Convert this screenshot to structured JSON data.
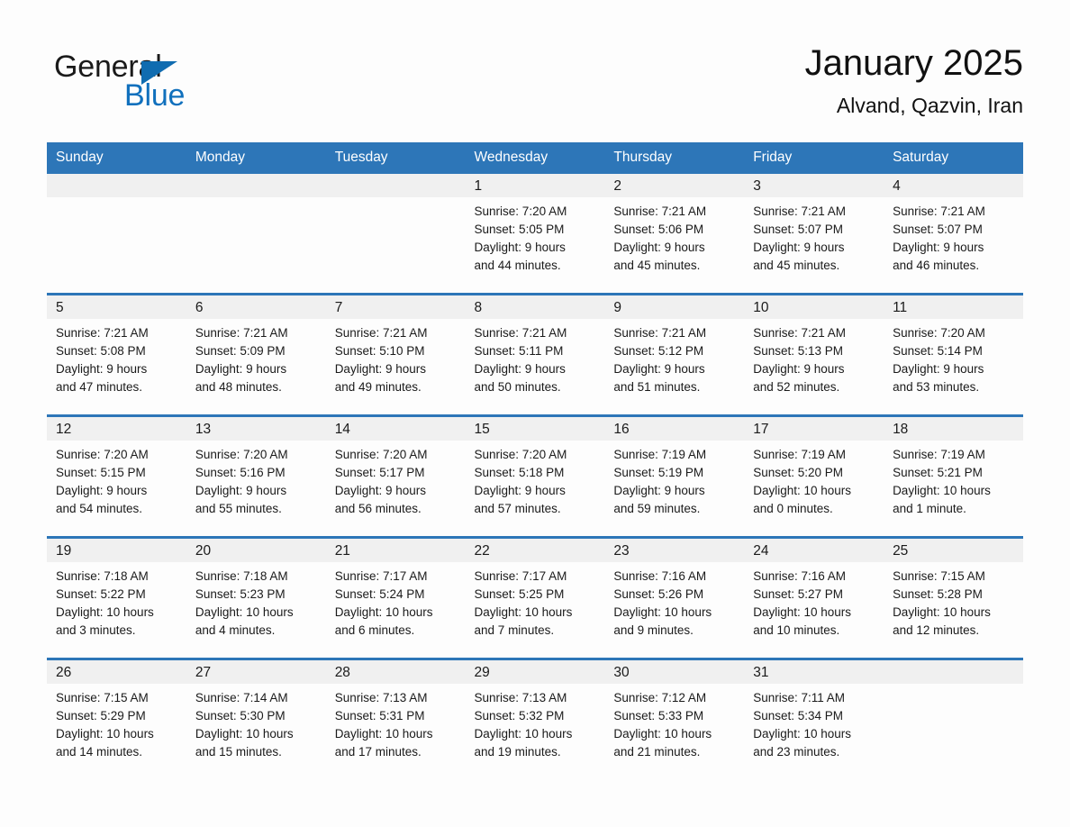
{
  "brand": {
    "name_part1": "General",
    "name_part2": "Blue",
    "accent_color": "#1070bd",
    "triangle_color": "#106cb0"
  },
  "header": {
    "title": "January 2025",
    "subtitle": "Alvand, Qazvin, Iran"
  },
  "theme": {
    "header_row_bg": "#2d76b8",
    "daynum_bg": "#f0f0f0",
    "page_bg": "#fdfdfd",
    "text_color": "#1a1a1a"
  },
  "weekday_headers": [
    "Sunday",
    "Monday",
    "Tuesday",
    "Wednesday",
    "Thursday",
    "Friday",
    "Saturday"
  ],
  "weeks": [
    [
      {
        "day": "",
        "empty": true,
        "sunrise": "",
        "sunset": "",
        "daylight_line1": "",
        "daylight_line2": ""
      },
      {
        "day": "",
        "empty": true,
        "sunrise": "",
        "sunset": "",
        "daylight_line1": "",
        "daylight_line2": ""
      },
      {
        "day": "",
        "empty": true,
        "sunrise": "",
        "sunset": "",
        "daylight_line1": "",
        "daylight_line2": ""
      },
      {
        "day": "1",
        "sunrise": "Sunrise: 7:20 AM",
        "sunset": "Sunset: 5:05 PM",
        "daylight_line1": "Daylight: 9 hours",
        "daylight_line2": "and 44 minutes."
      },
      {
        "day": "2",
        "sunrise": "Sunrise: 7:21 AM",
        "sunset": "Sunset: 5:06 PM",
        "daylight_line1": "Daylight: 9 hours",
        "daylight_line2": "and 45 minutes."
      },
      {
        "day": "3",
        "sunrise": "Sunrise: 7:21 AM",
        "sunset": "Sunset: 5:07 PM",
        "daylight_line1": "Daylight: 9 hours",
        "daylight_line2": "and 45 minutes."
      },
      {
        "day": "4",
        "sunrise": "Sunrise: 7:21 AM",
        "sunset": "Sunset: 5:07 PM",
        "daylight_line1": "Daylight: 9 hours",
        "daylight_line2": "and 46 minutes."
      }
    ],
    [
      {
        "day": "5",
        "sunrise": "Sunrise: 7:21 AM",
        "sunset": "Sunset: 5:08 PM",
        "daylight_line1": "Daylight: 9 hours",
        "daylight_line2": "and 47 minutes."
      },
      {
        "day": "6",
        "sunrise": "Sunrise: 7:21 AM",
        "sunset": "Sunset: 5:09 PM",
        "daylight_line1": "Daylight: 9 hours",
        "daylight_line2": "and 48 minutes."
      },
      {
        "day": "7",
        "sunrise": "Sunrise: 7:21 AM",
        "sunset": "Sunset: 5:10 PM",
        "daylight_line1": "Daylight: 9 hours",
        "daylight_line2": "and 49 minutes."
      },
      {
        "day": "8",
        "sunrise": "Sunrise: 7:21 AM",
        "sunset": "Sunset: 5:11 PM",
        "daylight_line1": "Daylight: 9 hours",
        "daylight_line2": "and 50 minutes."
      },
      {
        "day": "9",
        "sunrise": "Sunrise: 7:21 AM",
        "sunset": "Sunset: 5:12 PM",
        "daylight_line1": "Daylight: 9 hours",
        "daylight_line2": "and 51 minutes."
      },
      {
        "day": "10",
        "sunrise": "Sunrise: 7:21 AM",
        "sunset": "Sunset: 5:13 PM",
        "daylight_line1": "Daylight: 9 hours",
        "daylight_line2": "and 52 minutes."
      },
      {
        "day": "11",
        "sunrise": "Sunrise: 7:20 AM",
        "sunset": "Sunset: 5:14 PM",
        "daylight_line1": "Daylight: 9 hours",
        "daylight_line2": "and 53 minutes."
      }
    ],
    [
      {
        "day": "12",
        "sunrise": "Sunrise: 7:20 AM",
        "sunset": "Sunset: 5:15 PM",
        "daylight_line1": "Daylight: 9 hours",
        "daylight_line2": "and 54 minutes."
      },
      {
        "day": "13",
        "sunrise": "Sunrise: 7:20 AM",
        "sunset": "Sunset: 5:16 PM",
        "daylight_line1": "Daylight: 9 hours",
        "daylight_line2": "and 55 minutes."
      },
      {
        "day": "14",
        "sunrise": "Sunrise: 7:20 AM",
        "sunset": "Sunset: 5:17 PM",
        "daylight_line1": "Daylight: 9 hours",
        "daylight_line2": "and 56 minutes."
      },
      {
        "day": "15",
        "sunrise": "Sunrise: 7:20 AM",
        "sunset": "Sunset: 5:18 PM",
        "daylight_line1": "Daylight: 9 hours",
        "daylight_line2": "and 57 minutes."
      },
      {
        "day": "16",
        "sunrise": "Sunrise: 7:19 AM",
        "sunset": "Sunset: 5:19 PM",
        "daylight_line1": "Daylight: 9 hours",
        "daylight_line2": "and 59 minutes."
      },
      {
        "day": "17",
        "sunrise": "Sunrise: 7:19 AM",
        "sunset": "Sunset: 5:20 PM",
        "daylight_line1": "Daylight: 10 hours",
        "daylight_line2": "and 0 minutes."
      },
      {
        "day": "18",
        "sunrise": "Sunrise: 7:19 AM",
        "sunset": "Sunset: 5:21 PM",
        "daylight_line1": "Daylight: 10 hours",
        "daylight_line2": "and 1 minute."
      }
    ],
    [
      {
        "day": "19",
        "sunrise": "Sunrise: 7:18 AM",
        "sunset": "Sunset: 5:22 PM",
        "daylight_line1": "Daylight: 10 hours",
        "daylight_line2": "and 3 minutes."
      },
      {
        "day": "20",
        "sunrise": "Sunrise: 7:18 AM",
        "sunset": "Sunset: 5:23 PM",
        "daylight_line1": "Daylight: 10 hours",
        "daylight_line2": "and 4 minutes."
      },
      {
        "day": "21",
        "sunrise": "Sunrise: 7:17 AM",
        "sunset": "Sunset: 5:24 PM",
        "daylight_line1": "Daylight: 10 hours",
        "daylight_line2": "and 6 minutes."
      },
      {
        "day": "22",
        "sunrise": "Sunrise: 7:17 AM",
        "sunset": "Sunset: 5:25 PM",
        "daylight_line1": "Daylight: 10 hours",
        "daylight_line2": "and 7 minutes."
      },
      {
        "day": "23",
        "sunrise": "Sunrise: 7:16 AM",
        "sunset": "Sunset: 5:26 PM",
        "daylight_line1": "Daylight: 10 hours",
        "daylight_line2": "and 9 minutes."
      },
      {
        "day": "24",
        "sunrise": "Sunrise: 7:16 AM",
        "sunset": "Sunset: 5:27 PM",
        "daylight_line1": "Daylight: 10 hours",
        "daylight_line2": "and 10 minutes."
      },
      {
        "day": "25",
        "sunrise": "Sunrise: 7:15 AM",
        "sunset": "Sunset: 5:28 PM",
        "daylight_line1": "Daylight: 10 hours",
        "daylight_line2": "and 12 minutes."
      }
    ],
    [
      {
        "day": "26",
        "sunrise": "Sunrise: 7:15 AM",
        "sunset": "Sunset: 5:29 PM",
        "daylight_line1": "Daylight: 10 hours",
        "daylight_line2": "and 14 minutes."
      },
      {
        "day": "27",
        "sunrise": "Sunrise: 7:14 AM",
        "sunset": "Sunset: 5:30 PM",
        "daylight_line1": "Daylight: 10 hours",
        "daylight_line2": "and 15 minutes."
      },
      {
        "day": "28",
        "sunrise": "Sunrise: 7:13 AM",
        "sunset": "Sunset: 5:31 PM",
        "daylight_line1": "Daylight: 10 hours",
        "daylight_line2": "and 17 minutes."
      },
      {
        "day": "29",
        "sunrise": "Sunrise: 7:13 AM",
        "sunset": "Sunset: 5:32 PM",
        "daylight_line1": "Daylight: 10 hours",
        "daylight_line2": "and 19 minutes."
      },
      {
        "day": "30",
        "sunrise": "Sunrise: 7:12 AM",
        "sunset": "Sunset: 5:33 PM",
        "daylight_line1": "Daylight: 10 hours",
        "daylight_line2": "and 21 minutes."
      },
      {
        "day": "31",
        "sunrise": "Sunrise: 7:11 AM",
        "sunset": "Sunset: 5:34 PM",
        "daylight_line1": "Daylight: 10 hours",
        "daylight_line2": "and 23 minutes."
      },
      {
        "day": "",
        "empty": true,
        "sunrise": "",
        "sunset": "",
        "daylight_line1": "",
        "daylight_line2": ""
      }
    ]
  ]
}
